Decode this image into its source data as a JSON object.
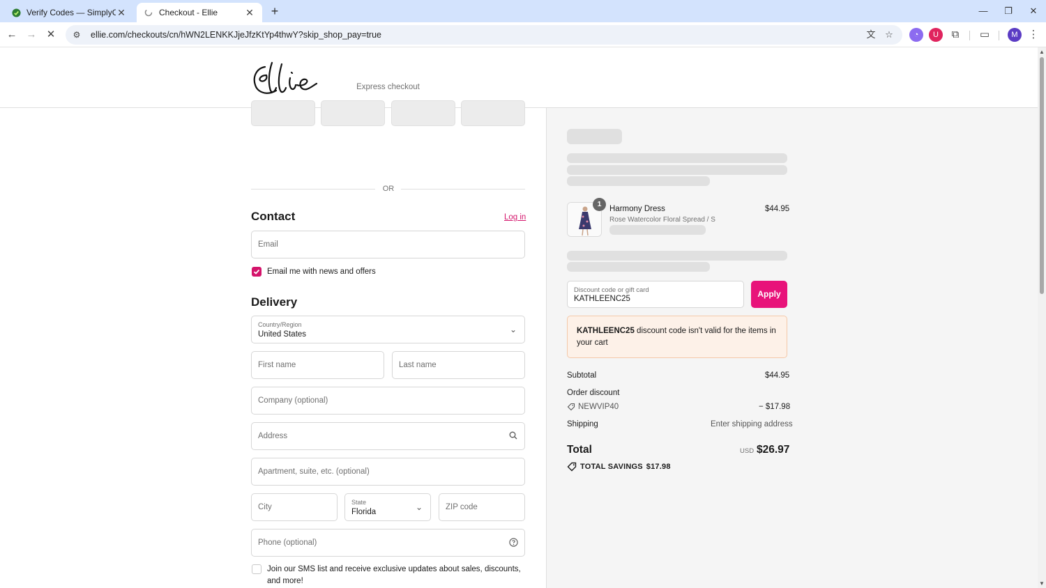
{
  "browser": {
    "tabs": [
      {
        "title": "Verify Codes — SimplyCodes",
        "active": false
      },
      {
        "title": "Checkout - Ellie",
        "active": true
      }
    ],
    "url": "ellie.com/checkouts/cn/hWN2LENKKJjeJfzKtYp4thwY?skip_shop_pay=true",
    "profile_initial": "M"
  },
  "checkout": {
    "express_checkout_label": "Express checkout",
    "or_label": "OR",
    "contact": {
      "heading": "Contact",
      "login_link": "Log in",
      "email_placeholder": "Email",
      "newsletter_label": "Email me with news and offers",
      "newsletter_checked": true
    },
    "delivery": {
      "heading": "Delivery",
      "country_label": "Country/Region",
      "country_value": "United States",
      "first_name_placeholder": "First name",
      "last_name_placeholder": "Last name",
      "company_placeholder": "Company (optional)",
      "address_placeholder": "Address",
      "apartment_placeholder": "Apartment, suite, etc. (optional)",
      "city_placeholder": "City",
      "state_label": "State",
      "state_value": "Florida",
      "zip_placeholder": "ZIP code",
      "phone_placeholder": "Phone (optional)",
      "sms_label": "Join our SMS list and receive exclusive updates about sales, discounts, and more!",
      "sms_checked": false
    }
  },
  "summary": {
    "item": {
      "quantity": "1",
      "name": "Harmony Dress",
      "variant": "Rose Watercolor Floral Spread / S",
      "price": "$44.95"
    },
    "discount_label": "Discount code or gift card",
    "discount_value": "KATHLEENC25",
    "apply_label": "Apply",
    "error_code": "KATHLEENC25",
    "error_message": " discount code isn't valid for the items in your cart",
    "subtotal_label": "Subtotal",
    "subtotal_value": "$44.95",
    "order_discount_label": "Order discount",
    "discount_code_applied": "NEWVIP40",
    "discount_amount": "− $17.98",
    "shipping_label": "Shipping",
    "shipping_value": "Enter shipping address",
    "total_label": "Total",
    "currency": "USD",
    "total_value": "$26.97",
    "savings_label": "TOTAL SAVINGS",
    "savings_value": "$17.98"
  },
  "colors": {
    "accent": "#e8137a",
    "error_bg": "#fdf1e8",
    "summary_bg": "#f5f5f5"
  }
}
